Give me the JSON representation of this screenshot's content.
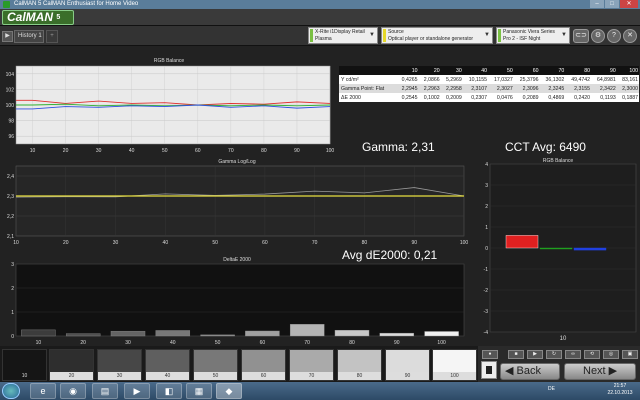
{
  "window": {
    "title": "CalMAN 5 CalMAN Enthusiast for Home Video"
  },
  "app": {
    "logo": "CalMAN",
    "logo_version": "5"
  },
  "tabs": [
    {
      "label": "History 1"
    }
  ],
  "devices": [
    {
      "line1": "X-Rite i1Display Retail",
      "line2": "Plasma",
      "color": "#7ac043"
    },
    {
      "line1": "Source",
      "line2": "Optical player or standalone generator",
      "color": "#e5d82a"
    },
    {
      "line1": "Panasonic Viera Series",
      "line2": "Pro 2 - ISF Night",
      "color": "#7ac043"
    }
  ],
  "rgb_balance": {
    "title": "RGB Balance",
    "y_ticks": [
      "104",
      "102",
      "100",
      "98",
      "96"
    ],
    "x_ticks": [
      "10",
      "20",
      "30",
      "40",
      "50",
      "60",
      "70",
      "80",
      "90",
      "100"
    ]
  },
  "stats_table": {
    "headers": [
      "10",
      "20",
      "30",
      "40",
      "50",
      "60",
      "70",
      "80",
      "90",
      "100"
    ],
    "rows": [
      {
        "label": "Y cd/m²",
        "values": [
          "0,4265",
          "2,0866",
          "5,2969",
          "10,1155",
          "17,0327",
          "25,3796",
          "36,1302",
          "49,4742",
          "64,8981",
          "83,161"
        ]
      },
      {
        "label": "Gamma Point: Flat",
        "values": [
          "2,2945",
          "2,2963",
          "2,2958",
          "2,3107",
          "2,3027",
          "2,3096",
          "2,3245",
          "2,3155",
          "2,3422",
          "2,3000"
        ]
      },
      {
        "label": "ΔE 2000",
        "values": [
          "0,2545",
          "0,1002",
          "0,2009",
          "0,2307",
          "0,0476",
          "0,2089",
          "0,4869",
          "0,2420",
          "0,1193",
          "0,1887"
        ]
      }
    ]
  },
  "summary": {
    "gamma": "Gamma: 2,31",
    "cct": "CCT Avg: 6490",
    "de": "Avg dE2000: 0,21"
  },
  "gamma_chart": {
    "title": "Gamma Log/Log",
    "y_ticks": [
      "2,4",
      "2,3",
      "2,2",
      "2,1"
    ],
    "x_ticks": [
      "10",
      "20",
      "30",
      "40",
      "50",
      "60",
      "70",
      "80",
      "90",
      "100"
    ]
  },
  "delta_chart": {
    "title": "DeltaE 2000",
    "y_ticks": [
      "3",
      "2",
      "1",
      "0"
    ],
    "x_ticks": [
      "10",
      "20",
      "30",
      "40",
      "50",
      "60",
      "70",
      "80",
      "90",
      "100"
    ]
  },
  "rgb_small": {
    "title": "RGB Balance",
    "y_ticks": [
      "4",
      "3",
      "2",
      "1",
      "0",
      "-1",
      "-2",
      "-3",
      "-4"
    ],
    "x_label": "10"
  },
  "swatches": [
    {
      "label": "10",
      "color": "#151515"
    },
    {
      "label": "20",
      "color": "#2e2e2e"
    },
    {
      "label": "30",
      "color": "#474747"
    },
    {
      "label": "40",
      "color": "#5f5f5f"
    },
    {
      "label": "50",
      "color": "#787878"
    },
    {
      "label": "60",
      "color": "#919191"
    },
    {
      "label": "70",
      "color": "#aaaaaa"
    },
    {
      "label": "80",
      "color": "#c3c3c3"
    },
    {
      "label": "90",
      "color": "#dcdcdc"
    },
    {
      "label": "100",
      "color": "#f5f5f5"
    }
  ],
  "nav": {
    "back": "Back",
    "next": "Next"
  },
  "taskbar": {
    "lang": "DE",
    "time": "21:57",
    "date": "22.10.2013"
  },
  "chart_data": [
    {
      "type": "line",
      "title": "RGB Balance",
      "x": [
        10,
        20,
        30,
        40,
        50,
        60,
        70,
        80,
        90,
        100
      ],
      "ylim": [
        95,
        105
      ],
      "series": [
        {
          "color": "#e03030",
          "values": [
            100.6,
            100.2,
            100.5,
            100.2,
            100.3,
            100.0,
            100.2,
            100.1,
            100.4,
            100.2
          ]
        },
        {
          "color": "#30b030",
          "values": [
            100.0,
            100.1,
            99.9,
            100.0,
            99.9,
            100.0,
            99.9,
            100.0,
            99.9,
            100.0
          ]
        },
        {
          "color": "#3050e0",
          "values": [
            99.5,
            99.8,
            99.7,
            99.9,
            99.8,
            100.0,
            99.7,
            99.9,
            99.6,
            99.8
          ]
        }
      ]
    },
    {
      "type": "line",
      "title": "Gamma Log/Log",
      "x": [
        10,
        20,
        30,
        40,
        50,
        60,
        70,
        80,
        90,
        100
      ],
      "ylim": [
        2.1,
        2.45
      ],
      "series": [
        {
          "color": "#999999",
          "values": [
            2.2945,
            2.2963,
            2.2958,
            2.3107,
            2.3027,
            2.3096,
            2.3245,
            2.3155,
            2.3422,
            2.3
          ]
        },
        {
          "color": "#e8e040",
          "values": [
            2.3,
            2.3,
            2.3,
            2.3,
            2.3,
            2.3,
            2.3,
            2.3,
            2.3,
            2.3
          ]
        }
      ]
    },
    {
      "type": "bar",
      "title": "DeltaE 2000",
      "categories": [
        "10",
        "20",
        "30",
        "40",
        "50",
        "60",
        "70",
        "80",
        "90",
        "100"
      ],
      "values": [
        0.2545,
        0.1002,
        0.2009,
        0.2307,
        0.0476,
        0.2089,
        0.4869,
        0.242,
        0.1193,
        0.1887
      ],
      "ylim": [
        0,
        3
      ]
    },
    {
      "type": "bar",
      "title": "RGB Balance",
      "categories": [
        "R",
        "G",
        "B"
      ],
      "values": [
        0.6,
        0.0,
        -0.1
      ],
      "colors": [
        "#e02020",
        "#20a020",
        "#2040e0"
      ],
      "ylim": [
        -4,
        4
      ]
    }
  ]
}
